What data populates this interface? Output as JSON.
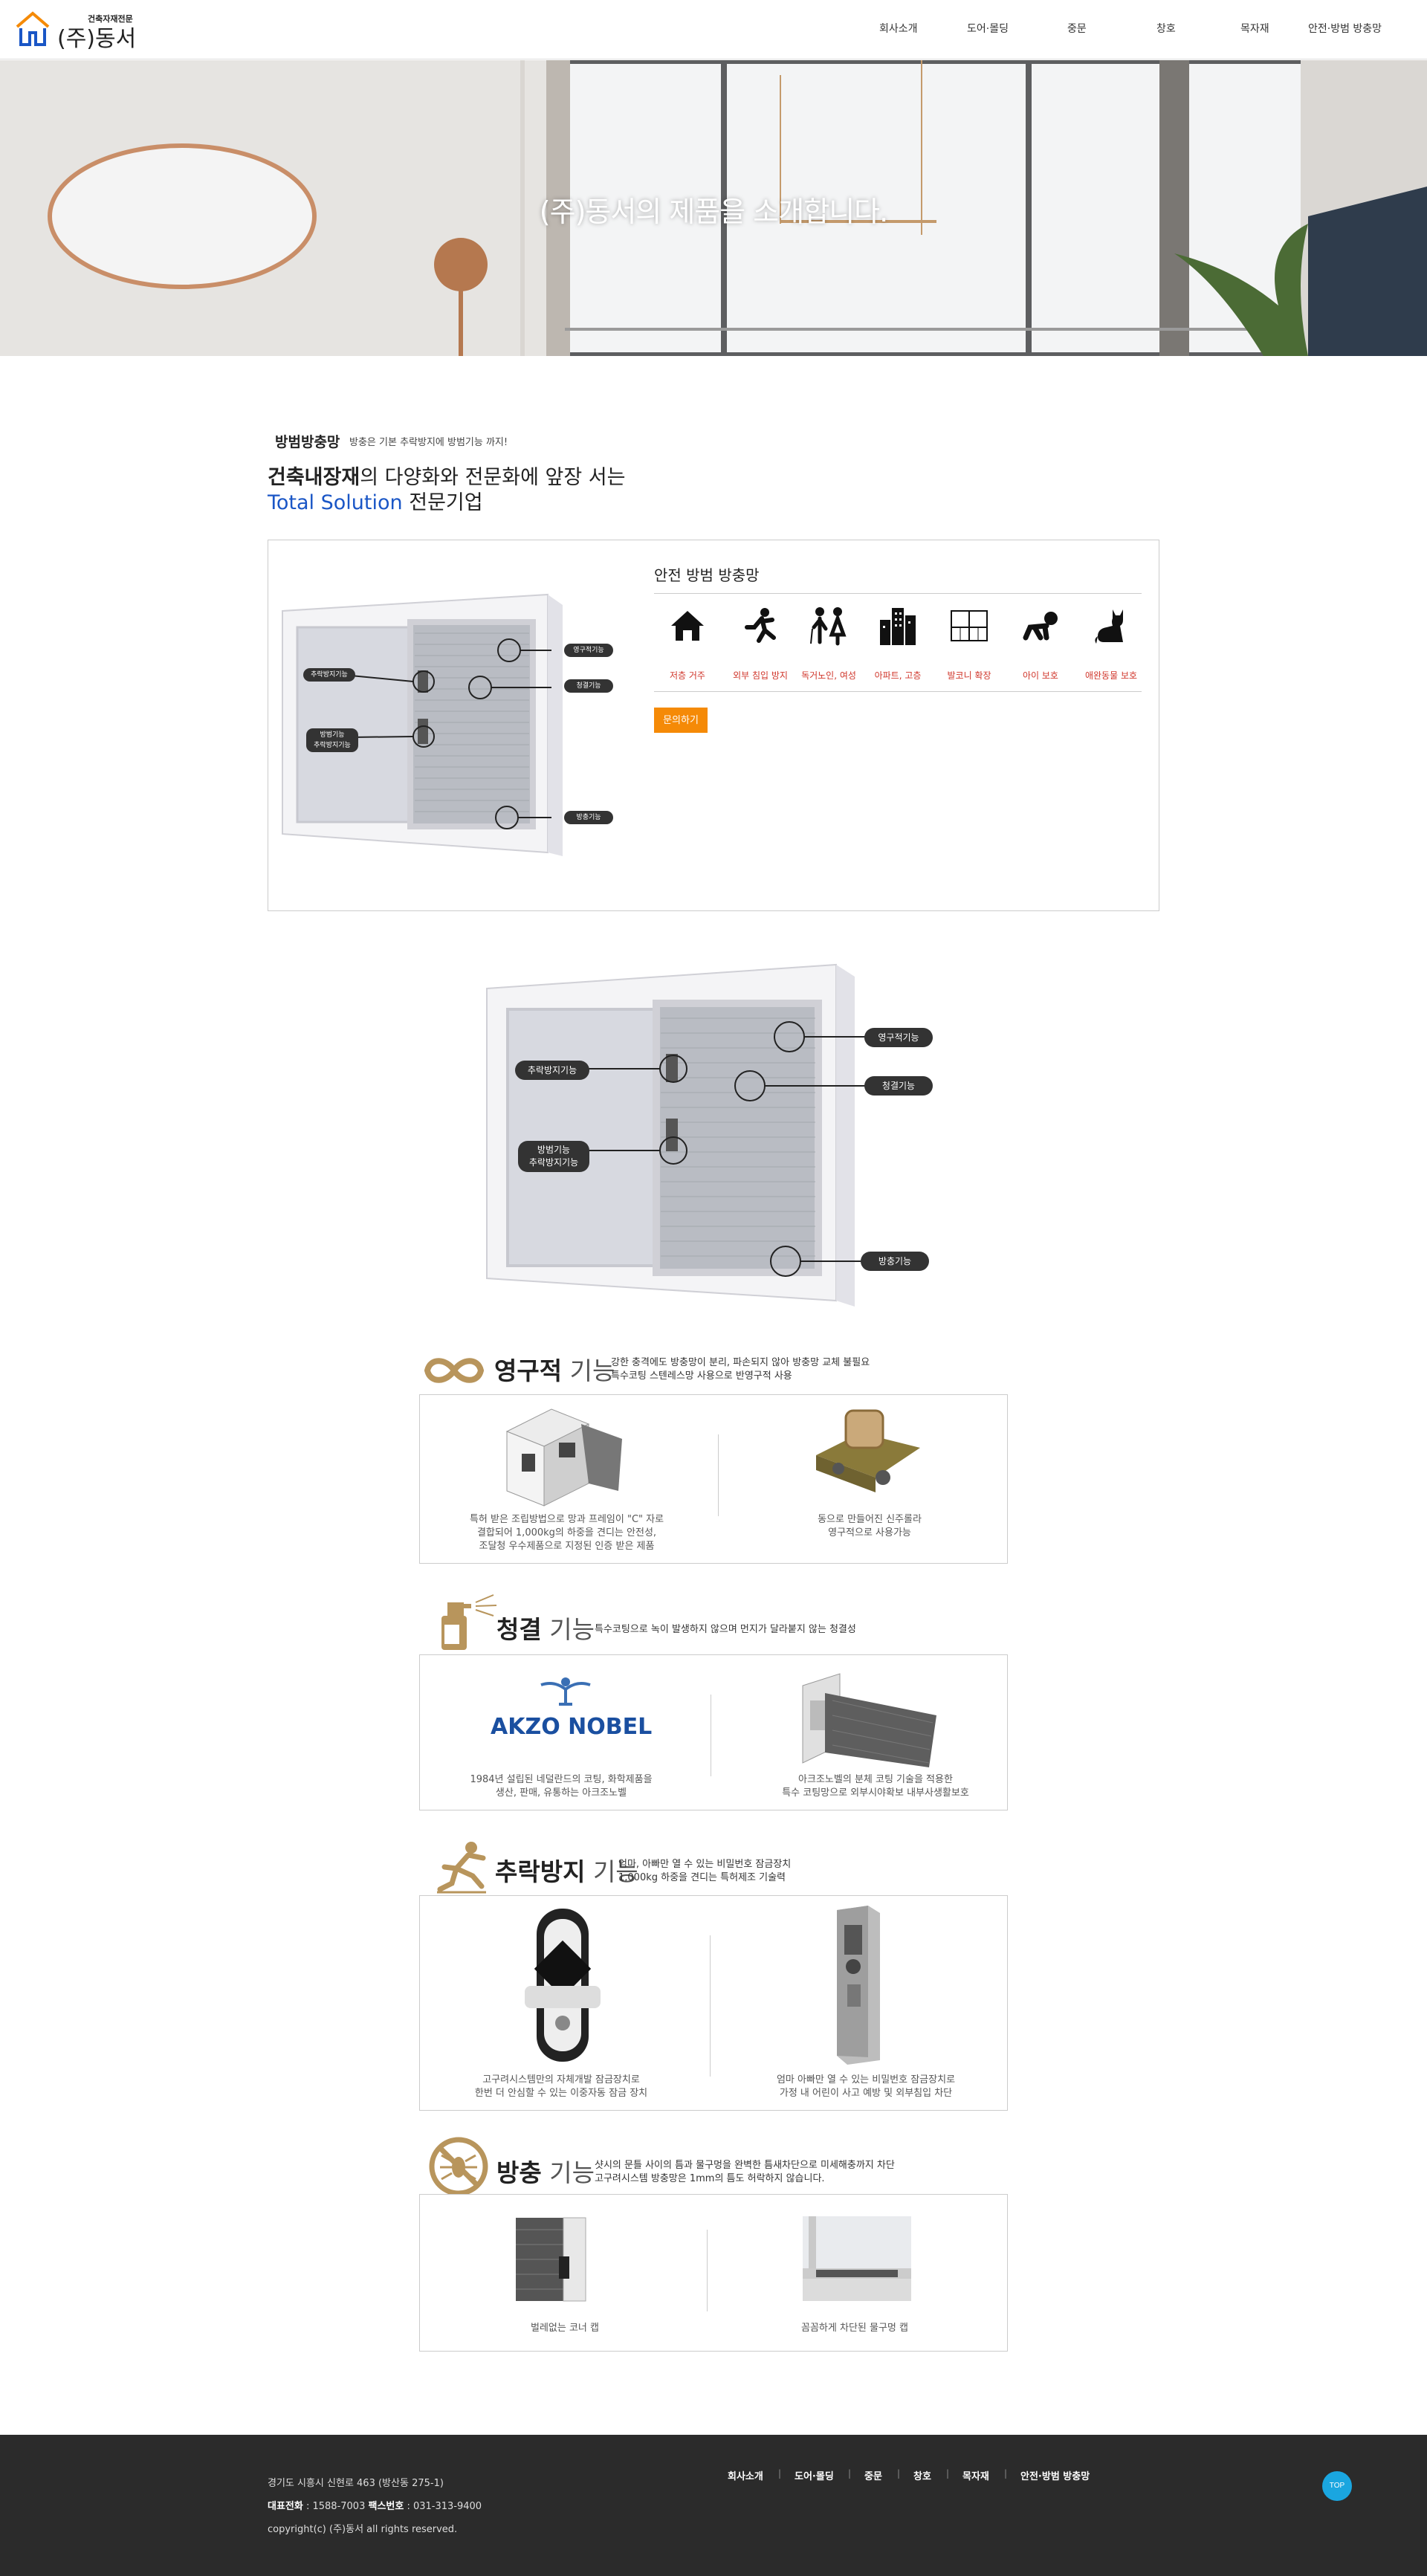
{
  "header": {
    "logo_small": "건축자재전문",
    "logo_big": "(주)동서",
    "nav": [
      "회사소개",
      "도어·몰딩",
      "중문",
      "창호",
      "목자재",
      "안전·방범 방충망"
    ]
  },
  "hero": {
    "title": "(주)동서의 제품을 소개합니다."
  },
  "intro": {
    "category": "방범방충망",
    "category_desc": "방충은 기본 추락방지에 방범기능 까지!",
    "headline_bold": "건축내장재",
    "headline_rest": "의 다양화와 전문화에 앞장 서는",
    "headline2_blue": "Total Solution",
    "headline2_rest": " 전문기업"
  },
  "product": {
    "title": "안전 방범 방충망",
    "features": [
      {
        "icon": "house-icon",
        "label": "저층 거주"
      },
      {
        "icon": "intruder-icon",
        "label": "외부 침입 방지"
      },
      {
        "icon": "elderly-couple-icon",
        "label": "독거노인, 여성"
      },
      {
        "icon": "buildings-icon",
        "label": "아파트, 고층"
      },
      {
        "icon": "balcony-icon",
        "label": "발코니 확장"
      },
      {
        "icon": "crawling-baby-icon",
        "label": "아이 보호"
      },
      {
        "icon": "cat-icon",
        "label": "애완동물 보호"
      }
    ],
    "inquiry": "문의하기",
    "small_labels": {
      "permanent": "영구적기능",
      "clean": "청결기능",
      "fall": "추락방지기능",
      "security": "방범기능",
      "security2": "추락방지기능",
      "insect": "방충기능"
    }
  },
  "diagram": {
    "permanent": "영구적기능",
    "clean": "청결기능",
    "fall": "추락방지기능",
    "security": "방범기능",
    "security2": "추락방지기능",
    "insect": "방충기능"
  },
  "sections": {
    "permanent": {
      "kw": "영구적",
      "kw2": " 기능",
      "desc1": "강한 충격에도 방충망이 분리, 파손되지 않아 방충망 교체 불필요",
      "desc2": "특수코팅 스텐레스망 사용으로 반영구적 사용",
      "cap_left1": "특허 받은 조립방법으로 망과 프레임이 \"C\" 자로",
      "cap_left2": "결합되어 1,000kg의 하중을 견디는 안전성,",
      "cap_left3": "조달청 우수제품으로 지정된 인증 받은 제품",
      "cap_right1": "동으로 만들어진 신주롤라",
      "cap_right2": "영구적으로 사용가능"
    },
    "clean": {
      "kw": "청결",
      "kw2": " 기능",
      "desc1": "특수코팅으로 녹이 발생하지 않으며 먼지가 달라붙지 않는 청결성",
      "akzo": "AKZO NOBEL",
      "cap_left1": "1984년 설립된 네덜란드의 코팅, 화학제품을",
      "cap_left2": "생산, 판매, 유통하는 아크조노벨",
      "cap_right1": "아크조노벨의 분체 코팅 기술을 적용한",
      "cap_right2": "특수 코팅망으로 외부시야확보 내부사생활보호"
    },
    "fall": {
      "kw": "추락방지",
      "kw2": " 기능",
      "desc1": "엄마, 아빠만 열 수 있는 비밀번호 잠금장치",
      "desc2": "1,000kg 하중을 견디는 특허제조 기술력",
      "cap_left1": "고구려시스템만의 자체개발 잠금장치로",
      "cap_left2": "한번 더 안심할 수 있는 이중자동 잠금 장치",
      "cap_right1": "엄마 아빠만 열 수 있는 비밀번호 잠금장치로",
      "cap_right2": "가정 내 어린이 사고 예방 및 외부침입 차단"
    },
    "insect": {
      "kw": "방충",
      "kw2": " 기능",
      "desc1": "샷시의 문틀 사이의 틈과 물구멍을 완벽한 틈새차단으로 미세해충까지 차단",
      "desc2": "고구려시스템 방충망은 1mm의 틈도 허락하지 않습니다.",
      "cap_left": "벌레없는 코너 캡",
      "cap_right": "꼼꼼하게 차단된 물구멍 캡"
    }
  },
  "footer": {
    "address": "경기도 시흥시 신현로 463 (방산동 275-1)",
    "tel_label": "대표전화",
    "tel": " : 1588-7003 ",
    "fax_label": "팩스번호",
    "fax": " : 031-313-9400",
    "copyright": "copyright(c) (주)동서 all rights reserved.",
    "nav": [
      "회사소개",
      "도어·몰딩",
      "중문",
      "창호",
      "목자재",
      "안전·방범 방충망"
    ],
    "top": "TOP"
  }
}
